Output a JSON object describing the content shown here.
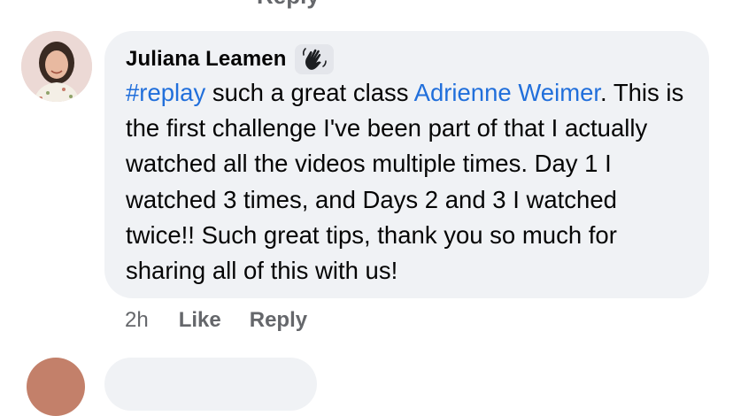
{
  "previous_comment": {
    "reply_label": "Reply"
  },
  "comment": {
    "author": "Juliana Leamen",
    "badge_icon": "waving-hand-icon",
    "hashtag": "#replay",
    "text_after_hashtag": " such a great class ",
    "mention": "Adrienne Weimer",
    "text_rest": ". This is the first challenge I've been part of that I actually watched all the videos multiple times. Day 1 I watched 3 times, and Days 2 and 3 I watched twice!! Such great tips, thank you so much for sharing all of this with us!",
    "timestamp": "2h",
    "like_label": "Like",
    "reply_label": "Reply"
  },
  "colors": {
    "bubble_bg": "#f0f2f5",
    "link": "#216fdb",
    "secondary_text": "#65676b"
  }
}
